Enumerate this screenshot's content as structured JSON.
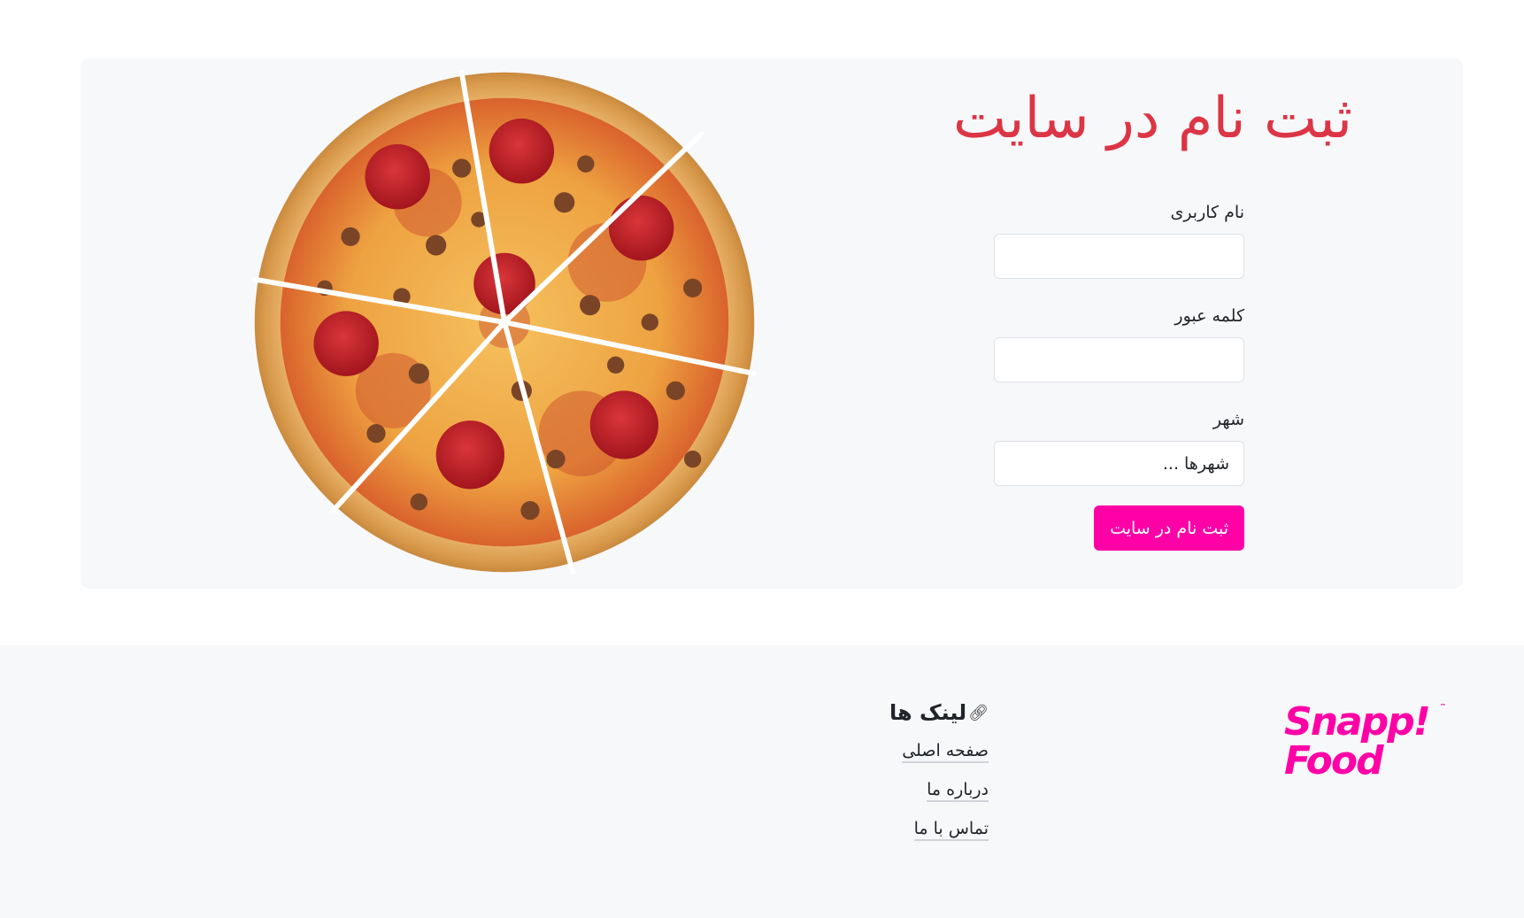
{
  "hero": {
    "title": "ثبت نام در سایت",
    "image": "pizza"
  },
  "form": {
    "username": {
      "label": "نام کاربری",
      "value": "",
      "placeholder": ""
    },
    "password": {
      "label": "کلمه عبور",
      "value": "",
      "placeholder": ""
    },
    "city": {
      "label": "شهر",
      "selected": "شهرها ..."
    },
    "submit_label": "ثبت نام در سایت"
  },
  "footer": {
    "logo": {
      "line1": "Snapp!",
      "line2": "Food",
      "trademark": "™"
    },
    "links": {
      "icon": "link-icon",
      "title": "لینک ها",
      "items": [
        "صفحه اصلی",
        "درباره ما",
        "تماس با ما"
      ]
    }
  },
  "colors": {
    "title": "#dc3545",
    "accent": "#ff00a6",
    "panel": "#f7f8fa"
  }
}
